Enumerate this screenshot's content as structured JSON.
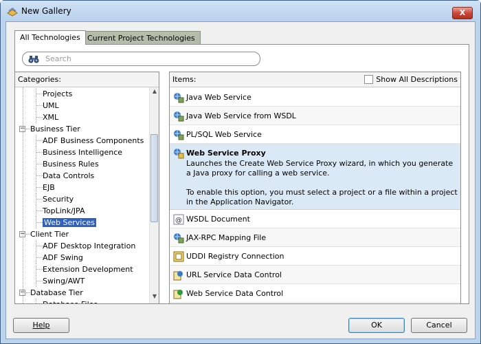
{
  "window": {
    "title": "New Gallery",
    "close_glyph": "X"
  },
  "tabs": [
    {
      "label": "All Technologies",
      "active": true
    },
    {
      "label": "Current Project Technologies",
      "active": false
    }
  ],
  "search": {
    "placeholder": "Search"
  },
  "categories": {
    "header": "Categories:",
    "tree": [
      {
        "label": "Projects",
        "level": 1
      },
      {
        "label": "UML",
        "level": 1
      },
      {
        "label": "XML",
        "level": 1
      },
      {
        "label": "Business Tier",
        "level": 0,
        "expanded": true
      },
      {
        "label": "ADF Business Components",
        "level": 1
      },
      {
        "label": "Business Intelligence",
        "level": 1
      },
      {
        "label": "Business Rules",
        "level": 1
      },
      {
        "label": "Data Controls",
        "level": 1
      },
      {
        "label": "EJB",
        "level": 1
      },
      {
        "label": "Security",
        "level": 1
      },
      {
        "label": "TopLink/JPA",
        "level": 1
      },
      {
        "label": "Web Services",
        "level": 1,
        "selected": true
      },
      {
        "label": "Client Tier",
        "level": 0,
        "expanded": true
      },
      {
        "label": "ADF Desktop Integration",
        "level": 1
      },
      {
        "label": "ADF Swing",
        "level": 1
      },
      {
        "label": "Extension Development",
        "level": 1
      },
      {
        "label": "Swing/AWT",
        "level": 1
      },
      {
        "label": "Database Tier",
        "level": 0,
        "expanded": true
      },
      {
        "label": "Database Files",
        "level": 1
      }
    ]
  },
  "items": {
    "header": "Items:",
    "show_all_label": "Show All Descriptions",
    "list": [
      {
        "label": "Java Web Service",
        "icon": "web-service-icon"
      },
      {
        "label": "Java Web Service from WSDL",
        "icon": "web-service-icon"
      },
      {
        "label": "PL/SQL Web Service",
        "icon": "web-service-icon"
      },
      {
        "label": "Web Service Proxy",
        "icon": "web-service-proxy-icon",
        "selected": true,
        "desc1": "Launches the Create Web Service Proxy wizard, in which you generate a Java proxy for calling a web service.",
        "desc2": "To enable this option, you must select a project or a file within a project in the Application Navigator."
      },
      {
        "label": "WSDL Document",
        "icon": "wsdl-document-icon"
      },
      {
        "label": "JAX-RPC Mapping File",
        "icon": "web-service-icon"
      },
      {
        "label": "UDDI Registry Connection",
        "icon": "uddi-registry-icon"
      },
      {
        "label": "URL Service Data Control",
        "icon": "url-data-control-icon"
      },
      {
        "label": "Web Service Data Control",
        "icon": "web-service-data-control-icon"
      }
    ]
  },
  "buttons": {
    "help": "Help",
    "ok": "OK",
    "cancel": "Cancel"
  },
  "colors": {
    "selection": "#3060c0",
    "selected_item_bg": "#dbe9f7",
    "title_bar": "#bcd3ec",
    "inactive_tab": "#b6bcaa"
  }
}
